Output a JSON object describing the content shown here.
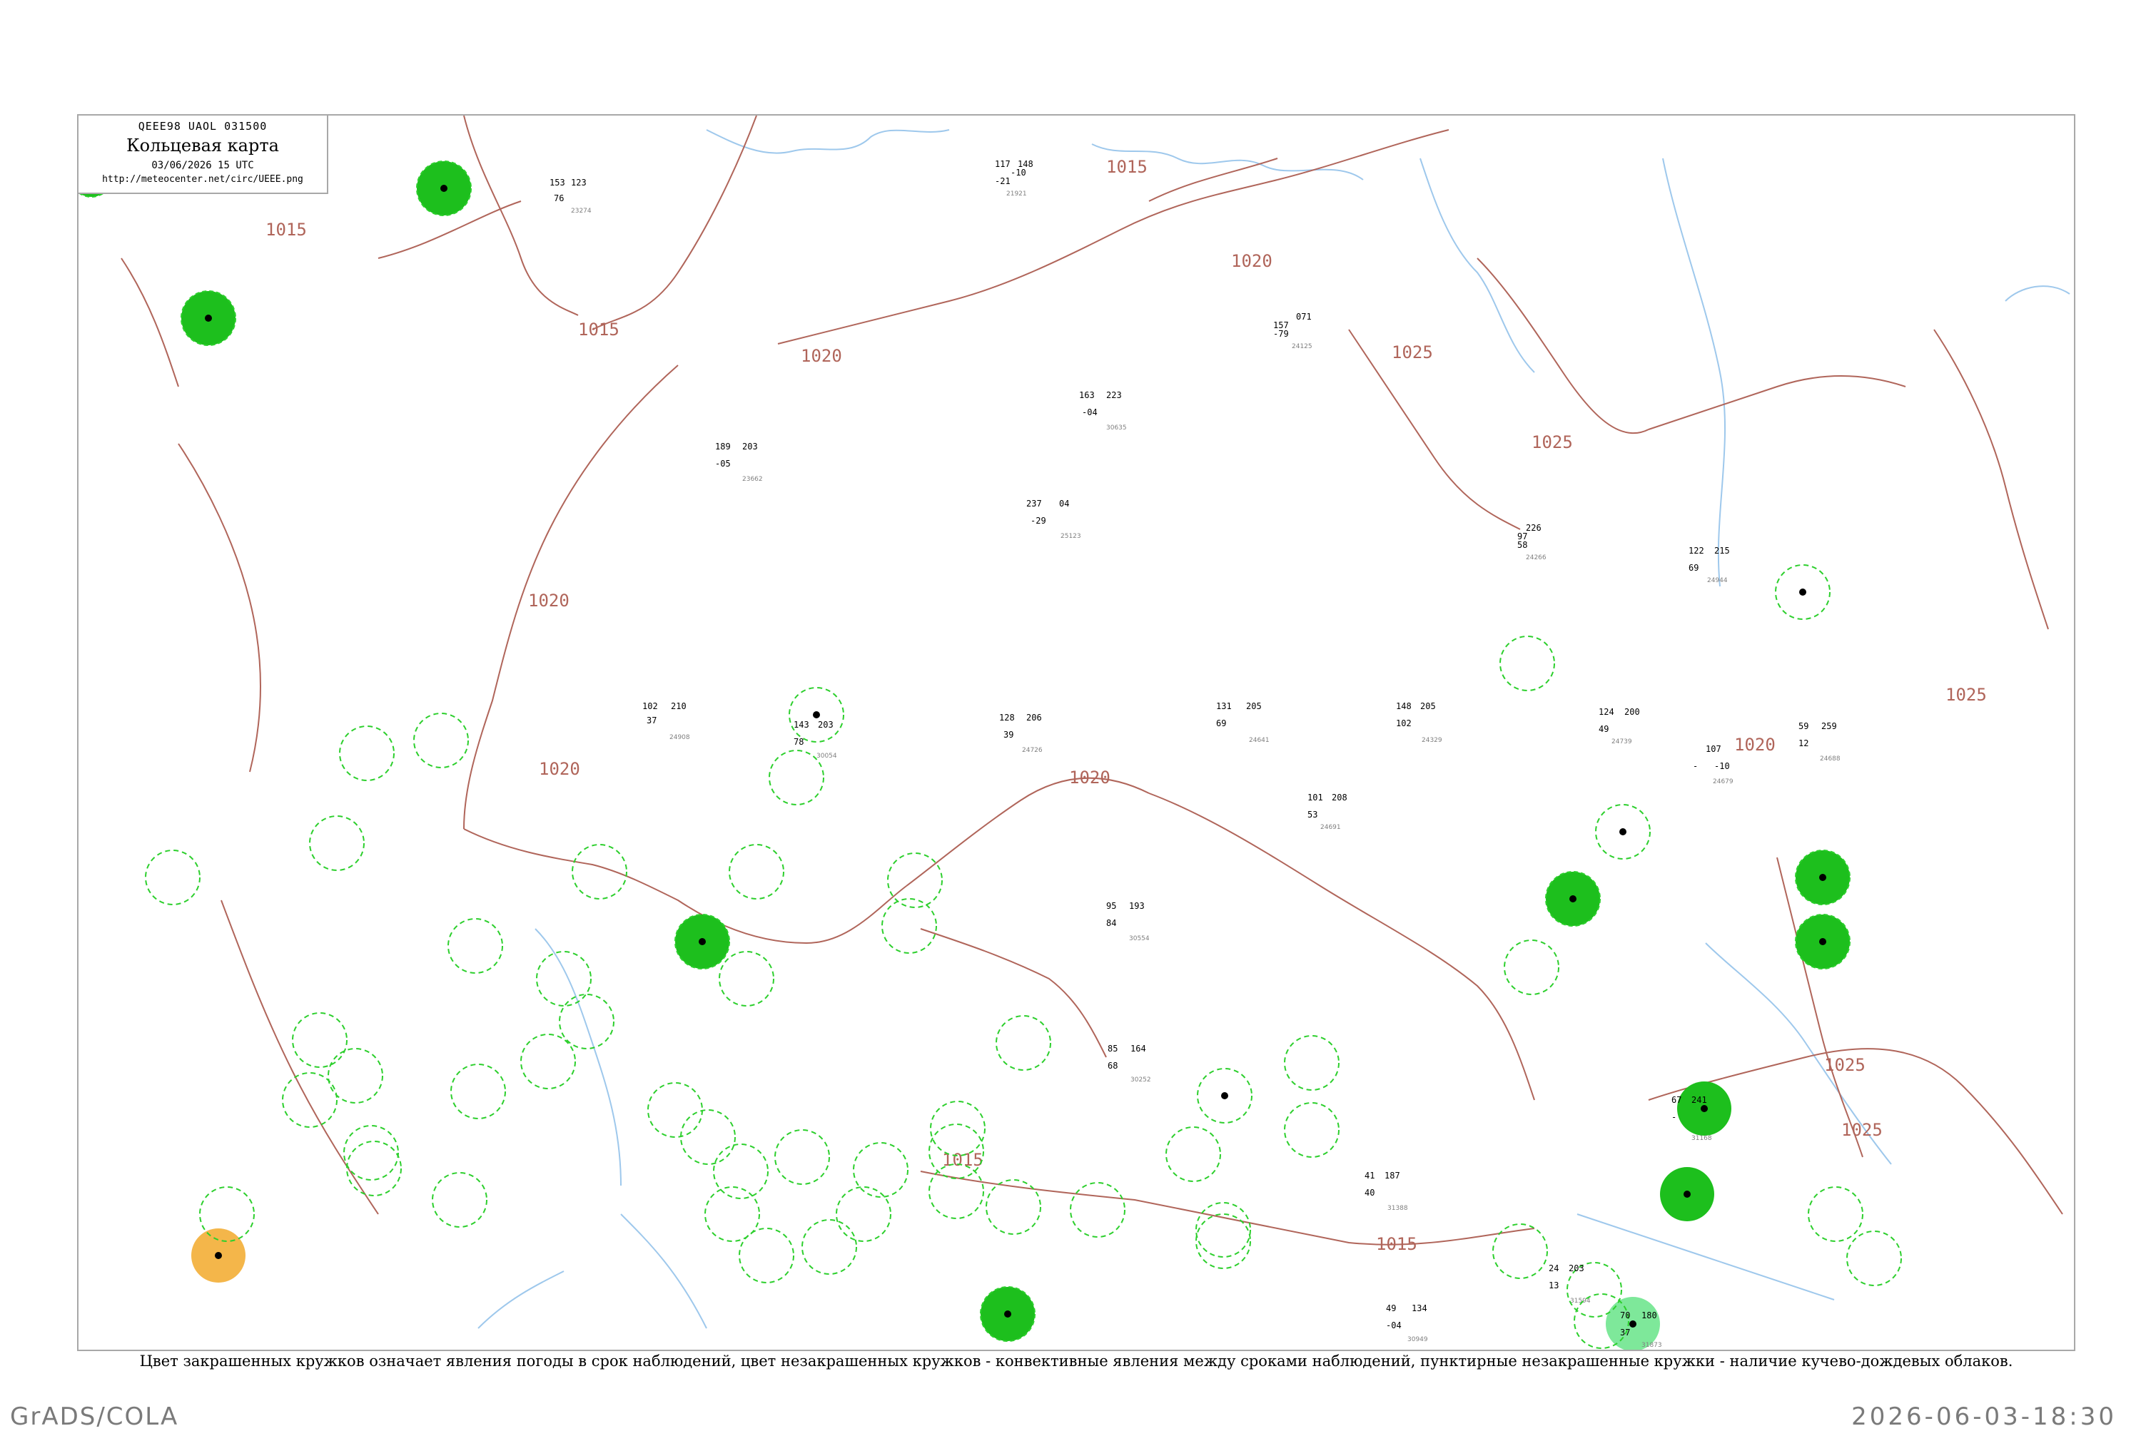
{
  "header": {
    "code": "QEEE98  UAOL  031500",
    "title": "Кольцевая карта",
    "datetime": "03/06/2026 15 UTC",
    "url": "http://meteocenter.net/circ/UEEE.png"
  },
  "colors": {
    "isobar": "#b0655a",
    "coast": "#9ec8ec",
    "precip_fill": "#1dbf1d",
    "convective_ring": "#2ccf2c",
    "thunder_fill": "#f4b64a",
    "light_precip_fill": "#7ee89a"
  },
  "isobar_labels": [
    "1015",
    "1020",
    "1025",
    "1015",
    "1020",
    "1025",
    "1020",
    "1015",
    "1020",
    "1025",
    "1015",
    "1015",
    "1020",
    "1025",
    "1020",
    "1025"
  ],
  "stations": [
    {
      "id": "21921",
      "p": "117",
      "t": "-10",
      "d": "-21",
      "tend": "148"
    },
    {
      "id": "23274",
      "p": "153",
      "t": "123",
      "d": "76"
    },
    {
      "id": "24266",
      "p": "226",
      "t": "97",
      "d": "58"
    },
    {
      "id": "24691",
      "p": "101",
      "t": "208",
      "d": "53"
    },
    {
      "id": "24739",
      "p": "124",
      "t": "200",
      "d": "49"
    },
    {
      "id": "25123",
      "p": "237",
      "t": "04",
      "d": "-29"
    },
    {
      "id": "24944",
      "p": "122",
      "t": "215",
      "d": "69"
    },
    {
      "id": "24908",
      "p": "102",
      "t": "210",
      "d": "37"
    },
    {
      "id": "24641",
      "p": "131",
      "t": "205",
      "d": "69"
    },
    {
      "id": "24329",
      "p": "148",
      "t": "205",
      "d": "102"
    },
    {
      "id": "30054",
      "p": "143",
      "t": "203",
      "d": "78"
    },
    {
      "id": "24726",
      "p": "128",
      "t": "206",
      "d": "39"
    },
    {
      "id": "30635",
      "p": "163",
      "t": "223",
      "d": "-04"
    },
    {
      "id": "24125",
      "p": "071",
      "t": "157",
      "d": "-79"
    },
    {
      "id": "23662",
      "p": "189",
      "t": "203",
      "d": "-05"
    },
    {
      "id": "30554",
      "p": "193",
      "t": "95",
      "d": "84"
    },
    {
      "id": "30252",
      "p": "164",
      "t": "85",
      "d": "68"
    },
    {
      "id": "30949",
      "p": "134",
      "t": "49",
      "d": "-04"
    },
    {
      "id": "31388",
      "p": "187",
      "t": "41",
      "d": "40"
    },
    {
      "id": "31594",
      "p": "203",
      "t": "24",
      "d": "13"
    },
    {
      "id": "31873",
      "p": "180",
      "t": "70",
      "d": "37"
    },
    {
      "id": "31168",
      "p": "241",
      "t": "67",
      "d": "-"
    },
    {
      "id": "24688",
      "p": "259",
      "t": "59",
      "d": "12"
    },
    {
      "id": "24679",
      "p": "107",
      "t": "-10",
      "d": "-"
    }
  ],
  "caption": "Цвет закрашенных кружков означает явления погоды в срок наблюдений, цвет незакрашенных кружков - конвективные явления между сроками наблюдений, пунктирные незакрашенные кружки - наличие кучево-дождевых облаков.",
  "footer": {
    "left": "GrADS/COLA",
    "right": "2026-06-03-18:30"
  }
}
